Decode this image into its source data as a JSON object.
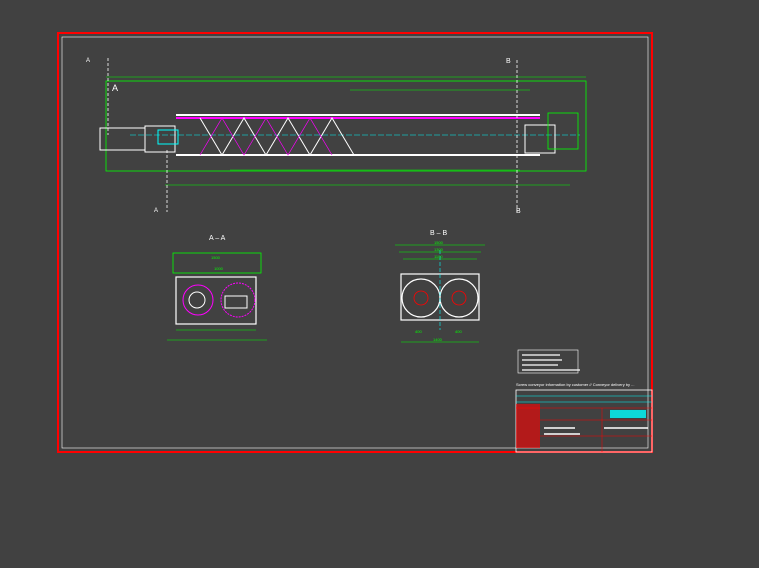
{
  "drawing": {
    "section_marker_a": "A",
    "section_marker_b": "B",
    "view_label_main": "A",
    "section_a_title": "A – A",
    "section_b_title": "B – B",
    "dim_b_1": "1500",
    "dim_b_2": "1300",
    "dim_b_3": "1100",
    "dim_b_4": "1400",
    "dim_b_5": "400",
    "dim_b_6": "400",
    "dim_a_1": "1500",
    "dim_a_2": "1000",
    "note_line": "Screw conveyor information by customer // Conveyor delivery by ..."
  },
  "colors": {
    "background": "#414141",
    "frame": "#ff0000",
    "outline": "#ffffff",
    "dimension": "#00ff00",
    "text": "#ffff00",
    "flight": "#ff00ff",
    "centerline": "#00ffff"
  }
}
